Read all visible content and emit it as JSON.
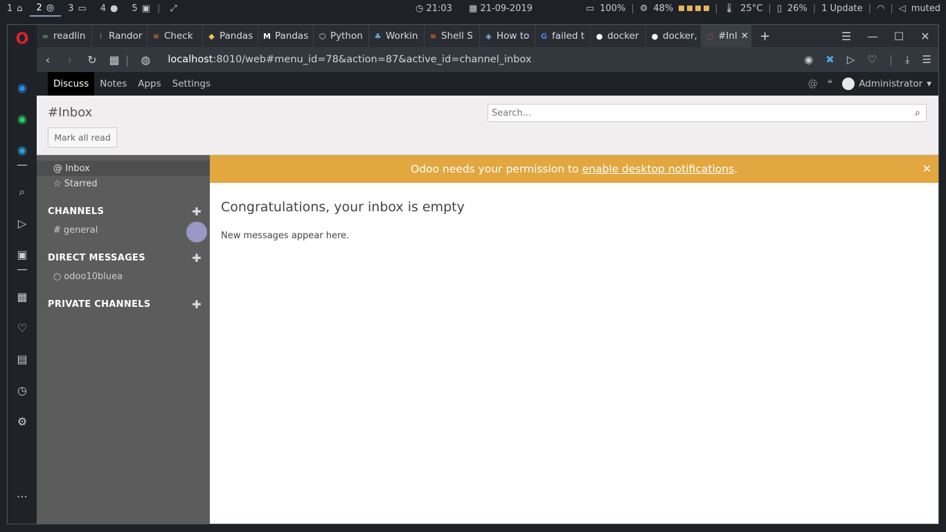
{
  "system_bar": {
    "workspaces": [
      {
        "num": "1",
        "icon": "home-icon"
      },
      {
        "num": "2",
        "icon": "chrome-icon"
      },
      {
        "num": "3",
        "icon": "folder-icon"
      },
      {
        "num": "4",
        "icon": "github-icon"
      },
      {
        "num": "5",
        "icon": "terminal-icon"
      }
    ],
    "time": "21:03",
    "date": "21-09-2019",
    "battery": "100%",
    "cpu": "48%",
    "temp": "25°C",
    "memory": "26%",
    "updates": "1 Update",
    "volume": "muted"
  },
  "tabs": [
    {
      "label": "readlin",
      "icon": "∞"
    },
    {
      "label": "Randor",
      "icon": "⁞"
    },
    {
      "label": "Check",
      "icon": "≡"
    },
    {
      "label": "Pandas",
      "icon": "◆"
    },
    {
      "label": "Pandas",
      "icon": "M"
    },
    {
      "label": "Python",
      "icon": "⬡"
    },
    {
      "label": "Workin",
      "icon": "♣"
    },
    {
      "label": "Shell S",
      "icon": "≡"
    },
    {
      "label": "How to",
      "icon": "◈"
    },
    {
      "label": "failed t",
      "icon": "G"
    },
    {
      "label": "docker",
      "icon": "●"
    },
    {
      "label": "docker,",
      "icon": "●"
    },
    {
      "label": "#Inl",
      "icon": "○"
    }
  ],
  "address": {
    "host": "localhost",
    "path": ":8010/web#menu_id=78&action=87&active_id=channel_inbox"
  },
  "odoo_nav": {
    "menu": [
      "Discuss",
      "Notes",
      "Apps",
      "Settings"
    ],
    "user": "Administrator"
  },
  "control_panel": {
    "title": "#Inbox",
    "mark_all_read": "Mark all read",
    "search_placeholder": "Search..."
  },
  "left_panel": {
    "inbox": "Inbox",
    "starred": "Starred",
    "channels_header": "CHANNELS",
    "channels": [
      "general"
    ],
    "dm_header": "DIRECT MESSAGES",
    "dms": [
      "odoo10bluea"
    ],
    "private_header": "PRIVATE CHANNELS"
  },
  "main": {
    "notice_text": "Odoo needs your permission to",
    "notice_link": "enable desktop notifications",
    "notice_end": ".",
    "empty_title": "Congratulations, your inbox is empty",
    "empty_sub": "New messages appear here."
  }
}
